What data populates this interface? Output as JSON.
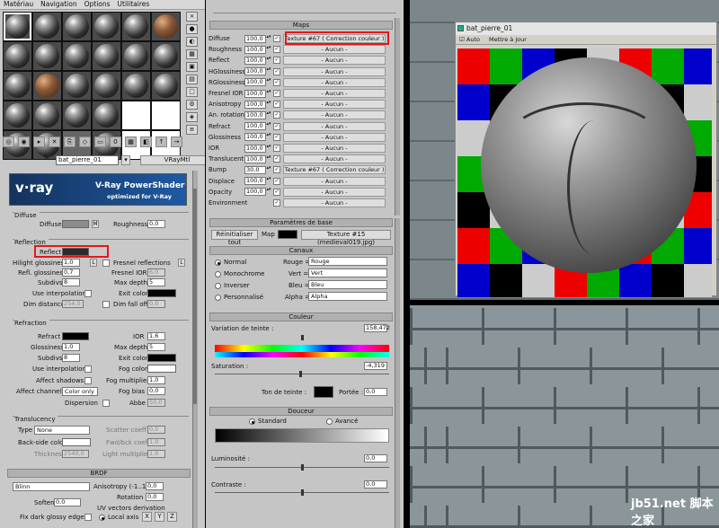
{
  "menu": [
    "Matériau",
    "Navigation",
    "Options",
    "Utilitaires"
  ],
  "slot_types": [
    "r",
    "r",
    "r",
    "r",
    "r",
    "b",
    "r",
    "r",
    "r",
    "r",
    "r",
    "r",
    "r",
    "b",
    "r",
    "r",
    "r",
    "r",
    "r",
    "r",
    "r",
    "r",
    "w",
    "w",
    "r",
    "r",
    "g",
    "r",
    "w",
    "w"
  ],
  "material": {
    "name": "bat_pierre_01",
    "type": "VRayMtl"
  },
  "banner": {
    "logo": "v·ray",
    "title": "V-Ray PowerShader",
    "subtitle": "optimized for V-Ray"
  },
  "diffuse": {
    "group": "Diffuse",
    "diffuse_label": "Diffuse",
    "m": "M",
    "roughness_label": "Roughness",
    "roughness": "0,0"
  },
  "reflection": {
    "group": "Reflection",
    "reflect": "Reflect",
    "hilight": "Hilight glossiness",
    "hilight_val": "1,0",
    "l": "L",
    "fresnel": "Fresnel reflections",
    "l2": "L",
    "refl_gloss": "Refl. glossiness",
    "refl_gloss_val": "0,7",
    "fresnel_ior": "Fresnel IOR",
    "fresnel_ior_val": "6,0",
    "subdivs": "Subdivs",
    "subdivs_val": "8",
    "max_depth": "Max depth",
    "max_depth_val": "5",
    "use_interp": "Use interpolation",
    "exit_color": "Exit color",
    "dim_dist": "Dim distance",
    "dim_dist_val": "254,0",
    "dim_falloff": "Dim fall off",
    "dim_falloff_val": "0,0"
  },
  "refraction": {
    "group": "Refraction",
    "refract": "Refract",
    "ior": "IOR",
    "ior_val": "1,6",
    "gloss": "Glossiness",
    "gloss_val": "1,0",
    "max_depth": "Max depth",
    "max_depth_val": "5",
    "subdivs": "Subdivs",
    "subdivs_val": "8",
    "exit_color": "Exit color",
    "use_interp": "Use interpolation",
    "fog_color": "Fog color",
    "affect_shadows": "Affect shadows",
    "fog_mult": "Fog multiplier",
    "fog_mult_val": "1,0",
    "affect_channels": "Affect channels",
    "affect_channels_val": "Color only",
    "fog_bias": "Fog bias",
    "fog_bias_val": "0,0",
    "dispersion": "Dispersion",
    "abbe": "Abbe",
    "abbe_val": "50,0"
  },
  "translucency": {
    "group": "Translucency",
    "type": "Type",
    "type_val": "None",
    "scatter": "Scatter coeff",
    "scatter_val": "0,0",
    "backside": "Back-side color",
    "fwd": "Fwd/bck coeff",
    "fwd_val": "1,0",
    "thickness": "Thickness",
    "thickness_val": "2540,0",
    "light_mult": "Light multiplier",
    "light_mult_val": "1,0"
  },
  "brdf": {
    "header": "BRDF",
    "type": "Blinn",
    "aniso": "Anisotropy (-1..1)",
    "aniso_val": "0,0",
    "rotation": "Rotation",
    "rotation_val": "0,0",
    "soften": "Soften",
    "soften_val": "0,0",
    "uv": "UV vectors derivation",
    "fix": "Fix dark glossy edges",
    "local": "Local axis",
    "x": "X",
    "y": "Y",
    "z": "Z"
  },
  "maps": {
    "header": "Maps",
    "rows": [
      {
        "name": "Diffuse",
        "amount": "100,0",
        "map": "Texture #67  ( Correction couleur )"
      },
      {
        "name": "Roughness",
        "amount": "100,0",
        "map": "- Aucun -"
      },
      {
        "name": "Reflect",
        "amount": "100,0",
        "map": "- Aucun -"
      },
      {
        "name": "HGlossiness",
        "amount": "100,0",
        "map": "- Aucun -"
      },
      {
        "name": "RGlossiness",
        "amount": "100,0",
        "map": "- Aucun -"
      },
      {
        "name": "Fresnel IOR",
        "amount": "100,0",
        "map": "- Aucun -"
      },
      {
        "name": "Anisotropy",
        "amount": "100,0",
        "map": "- Aucun -"
      },
      {
        "name": "An. rotation",
        "amount": "100,0",
        "map": "- Aucun -"
      },
      {
        "name": "Refract",
        "amount": "100,0",
        "map": "- Aucun -"
      },
      {
        "name": "Glossiness",
        "amount": "100,0",
        "map": "- Aucun -"
      },
      {
        "name": "IOR",
        "amount": "100,0",
        "map": "- Aucun -"
      },
      {
        "name": "Translucent",
        "amount": "100,0",
        "map": "- Aucun -"
      },
      {
        "name": "Bump",
        "amount": "30,0",
        "map": "Texture #67  ( Correction couleur )"
      },
      {
        "name": "Displace",
        "amount": "100,0",
        "map": "- Aucun -"
      },
      {
        "name": "Opacity",
        "amount": "100,0",
        "map": "- Aucun -"
      },
      {
        "name": "Environment",
        "amount": "",
        "map": "- Aucun -"
      }
    ]
  },
  "basic": {
    "header": "Paramètres de base",
    "reset": "Réinitialiser tout",
    "map": "Map :",
    "texture": "Texture #15 (medieval019.jpg)"
  },
  "channels": {
    "header": "Canaux",
    "modes": [
      "Normal",
      "Monochrome",
      "Inverser",
      "Personnalisé"
    ],
    "rouge": "Rouge =",
    "rouge_val": "Rouge",
    "vert": "Vert =",
    "vert_val": "Vert",
    "bleu": "Bleu =",
    "bleu_val": "Bleu",
    "alpha": "Alpha =",
    "alpha_val": "Alpha"
  },
  "color": {
    "header": "Couleur",
    "hue_var": "Variation de teinte :",
    "hue_val": "158,472",
    "sat": "Saturation :",
    "sat_val": "-4,319",
    "tint": "Ton de teinte :",
    "portee": "Portée :",
    "portee_val": "0,0"
  },
  "softness": {
    "header": "Douceur",
    "standard": "Standard",
    "advanced": "Avancé",
    "lum": "Luminosité :",
    "lum_val": "0,0",
    "contrast": "Contraste :",
    "contrast_val": "0,0"
  },
  "render": {
    "title": "bat_pierre_01",
    "auto": "Auto",
    "set": "Mettre à jour"
  },
  "watermark": "jb51.net 脚本之家",
  "colors": {
    "accent_red": "#e0191b",
    "vray_blue": "#1e5aa3"
  }
}
